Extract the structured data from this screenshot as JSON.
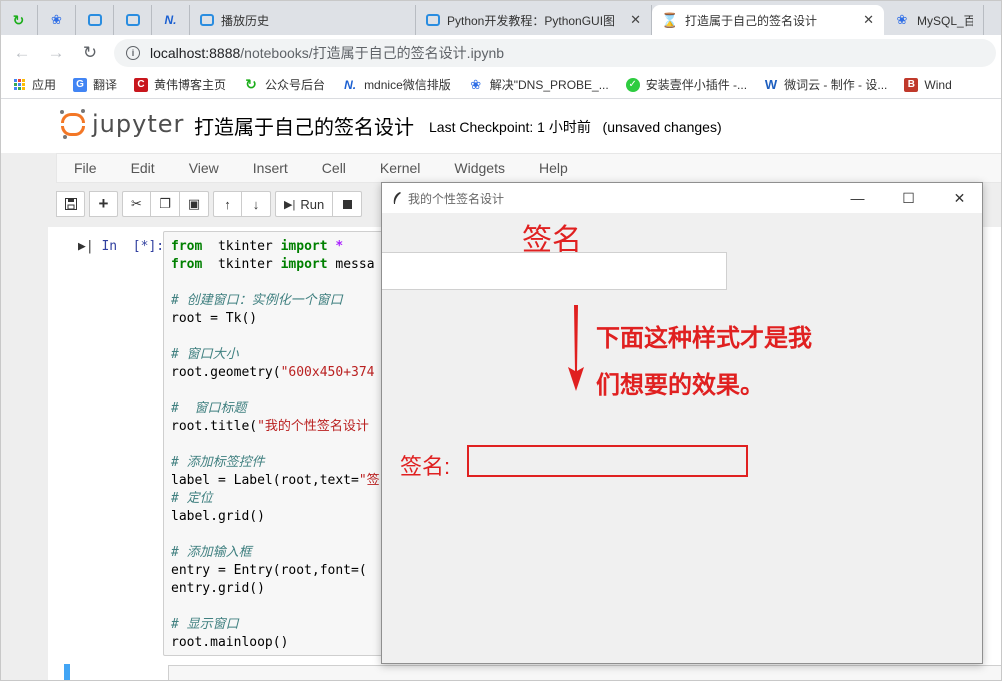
{
  "browser": {
    "tabs": [
      {
        "label": "",
        "icon": "green-swirl-icon"
      },
      {
        "label": "",
        "icon": "baidu-paw-icon"
      },
      {
        "label": "",
        "icon": "bilibili-tv-icon"
      },
      {
        "label": "",
        "icon": "bilibili-tv-icon"
      },
      {
        "label": "",
        "icon": "mdnice-icon"
      },
      {
        "label": "播放历史",
        "icon": "bilibili-tv-icon"
      },
      {
        "label": "Python开发教程：PythonGUI图",
        "icon": "bilibili-tv-icon"
      },
      {
        "label": "打造属于自己的签名设计",
        "icon": "hourglass-icon",
        "active": true
      },
      {
        "label": "MySQL_百",
        "icon": "baidu-paw-icon"
      }
    ],
    "url_host": "localhost:8888",
    "url_path": "/notebooks/打造属于自己的签名设计.ipynb",
    "bookmarks": [
      {
        "label": "应用",
        "icon": "apps-icon"
      },
      {
        "label": "翻译",
        "icon": "translate-icon"
      },
      {
        "label": "黄伟博客主页",
        "icon": "csdn-icon"
      },
      {
        "label": "公众号后台",
        "icon": "green-swirl-icon"
      },
      {
        "label": "mdnice微信排版",
        "icon": "mdnice-icon"
      },
      {
        "label": "解决\"DNS_PROBE_...",
        "icon": "baidu-paw-icon"
      },
      {
        "label": "安装壹伴小插件 -...",
        "icon": "check-icon"
      },
      {
        "label": "微词云 - 制作 - 设...",
        "icon": "weiciyun-icon"
      },
      {
        "label": "Wind",
        "icon": "b-icon"
      }
    ]
  },
  "jupyter": {
    "logo_text": "jupyter",
    "notebook_name": "打造属于自己的签名设计",
    "checkpoint": "Last Checkpoint: 1 小时前",
    "unsaved": "(unsaved changes)",
    "menu": [
      "File",
      "Edit",
      "View",
      "Insert",
      "Cell",
      "Kernel",
      "Widgets",
      "Help"
    ],
    "run_label": "Run",
    "prompt": "In  [*]:",
    "code_lines": [
      [
        [
          "kw",
          "from"
        ],
        [
          "",
          "  tkinter "
        ],
        [
          "kw",
          "import"
        ],
        [
          "op",
          " *"
        ]
      ],
      [
        [
          "kw",
          "from"
        ],
        [
          "",
          "  tkinter "
        ],
        [
          "kw",
          "import"
        ],
        [
          "",
          " messa"
        ]
      ],
      [
        [
          "",
          ""
        ]
      ],
      [
        [
          "cm",
          "# 创建窗口：实例化一个窗口"
        ]
      ],
      [
        [
          "",
          "root = Tk()"
        ]
      ],
      [
        [
          "",
          ""
        ]
      ],
      [
        [
          "cm",
          "# 窗口大小"
        ]
      ],
      [
        [
          "",
          "root.geometry("
        ],
        [
          "st",
          "\"600x450+374"
        ]
      ],
      [
        [
          "",
          ""
        ]
      ],
      [
        [
          "cm",
          "#  窗口标题"
        ]
      ],
      [
        [
          "",
          "root.title("
        ],
        [
          "st",
          "\"我的个性签名设计"
        ]
      ],
      [
        [
          "",
          ""
        ]
      ],
      [
        [
          "cm",
          "# 添加标签控件"
        ]
      ],
      [
        [
          "",
          "label = Label(root,text="
        ],
        [
          "st",
          "\"签"
        ]
      ],
      [
        [
          "cm",
          "# 定位"
        ]
      ],
      [
        [
          "",
          "label.grid()"
        ]
      ],
      [
        [
          "",
          ""
        ]
      ],
      [
        [
          "cm",
          "# 添加输入框"
        ]
      ],
      [
        [
          "",
          "entry = Entry(root,font=("
        ]
      ],
      [
        [
          "",
          "entry.grid()"
        ]
      ],
      [
        [
          "",
          ""
        ]
      ],
      [
        [
          "cm",
          "# 显示窗口"
        ]
      ],
      [
        [
          "",
          "root.mainloop()"
        ]
      ]
    ]
  },
  "tkwindow": {
    "title": "我的个性签名设计",
    "label": "签名",
    "note_line1": "下面这种样式才是我",
    "note_line2": "们想要的效果。",
    "sig_label": "签名:",
    "accent": "#e02020"
  }
}
